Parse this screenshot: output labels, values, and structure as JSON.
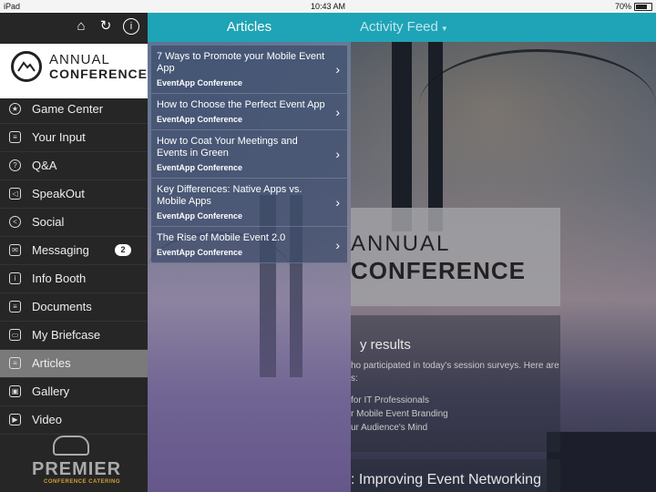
{
  "status_bar": {
    "device": "iPad",
    "time": "10:43 AM",
    "battery": "70%",
    "battery_level": 0.7
  },
  "sidebar": {
    "logo": {
      "line1": "ANNUAL",
      "line2": "CONFERENCE"
    },
    "top_icons": [
      "home-icon",
      "refresh-icon",
      "info-icon"
    ],
    "items": [
      {
        "label": "Game Center",
        "icon": "star-icon"
      },
      {
        "label": "Your Input",
        "icon": "checklist-icon"
      },
      {
        "label": "Q&A",
        "icon": "question-icon"
      },
      {
        "label": "SpeakOut",
        "icon": "megaphone-icon"
      },
      {
        "label": "Social",
        "icon": "share-icon"
      },
      {
        "label": "Messaging",
        "icon": "envelope-icon",
        "badge": "2"
      },
      {
        "label": "Info Booth",
        "icon": "info-booth-icon"
      },
      {
        "label": "Documents",
        "icon": "document-icon"
      },
      {
        "label": "My Briefcase",
        "icon": "briefcase-icon"
      },
      {
        "label": "Articles",
        "icon": "article-icon",
        "active": true
      },
      {
        "label": "Gallery",
        "icon": "gallery-icon"
      },
      {
        "label": "Video",
        "icon": "video-icon"
      }
    ],
    "sponsor": {
      "name": "PREMIER",
      "tagline": "CONFERENCE CATERING"
    }
  },
  "articles": {
    "title": "Articles",
    "items": [
      {
        "title": "7 Ways to Promote your Mobile Event App",
        "source": "EventApp Conference"
      },
      {
        "title": "How to Choose the Perfect Event App",
        "source": "EventApp Conference"
      },
      {
        "title": "How to Coat Your Meetings and Events in Green",
        "source": "EventApp Conference"
      },
      {
        "title": "Key Differences:  Native Apps vs. Mobile Apps",
        "source": "EventApp Conference"
      },
      {
        "title": "The Rise of Mobile Event 2.0",
        "source": "EventApp Conference"
      }
    ]
  },
  "feed": {
    "title": "Activity Feed",
    "banner": {
      "line1": "ANNUAL",
      "line2": "CONFERENCE"
    },
    "card": {
      "heading": "y results",
      "lines": [
        "ho participated in today's session surveys. Here are",
        "s:",
        "for IT Professionals",
        "r Mobile Event Branding",
        "ur Audience's Mind"
      ]
    },
    "card2": {
      "heading": ": Improving Event Networking"
    }
  },
  "colors": {
    "header_teal": "#1ea4b6",
    "sidebar_bg": "#262626",
    "active_item": "#7a7a7a",
    "sponsor_gold": "#d3a030"
  }
}
